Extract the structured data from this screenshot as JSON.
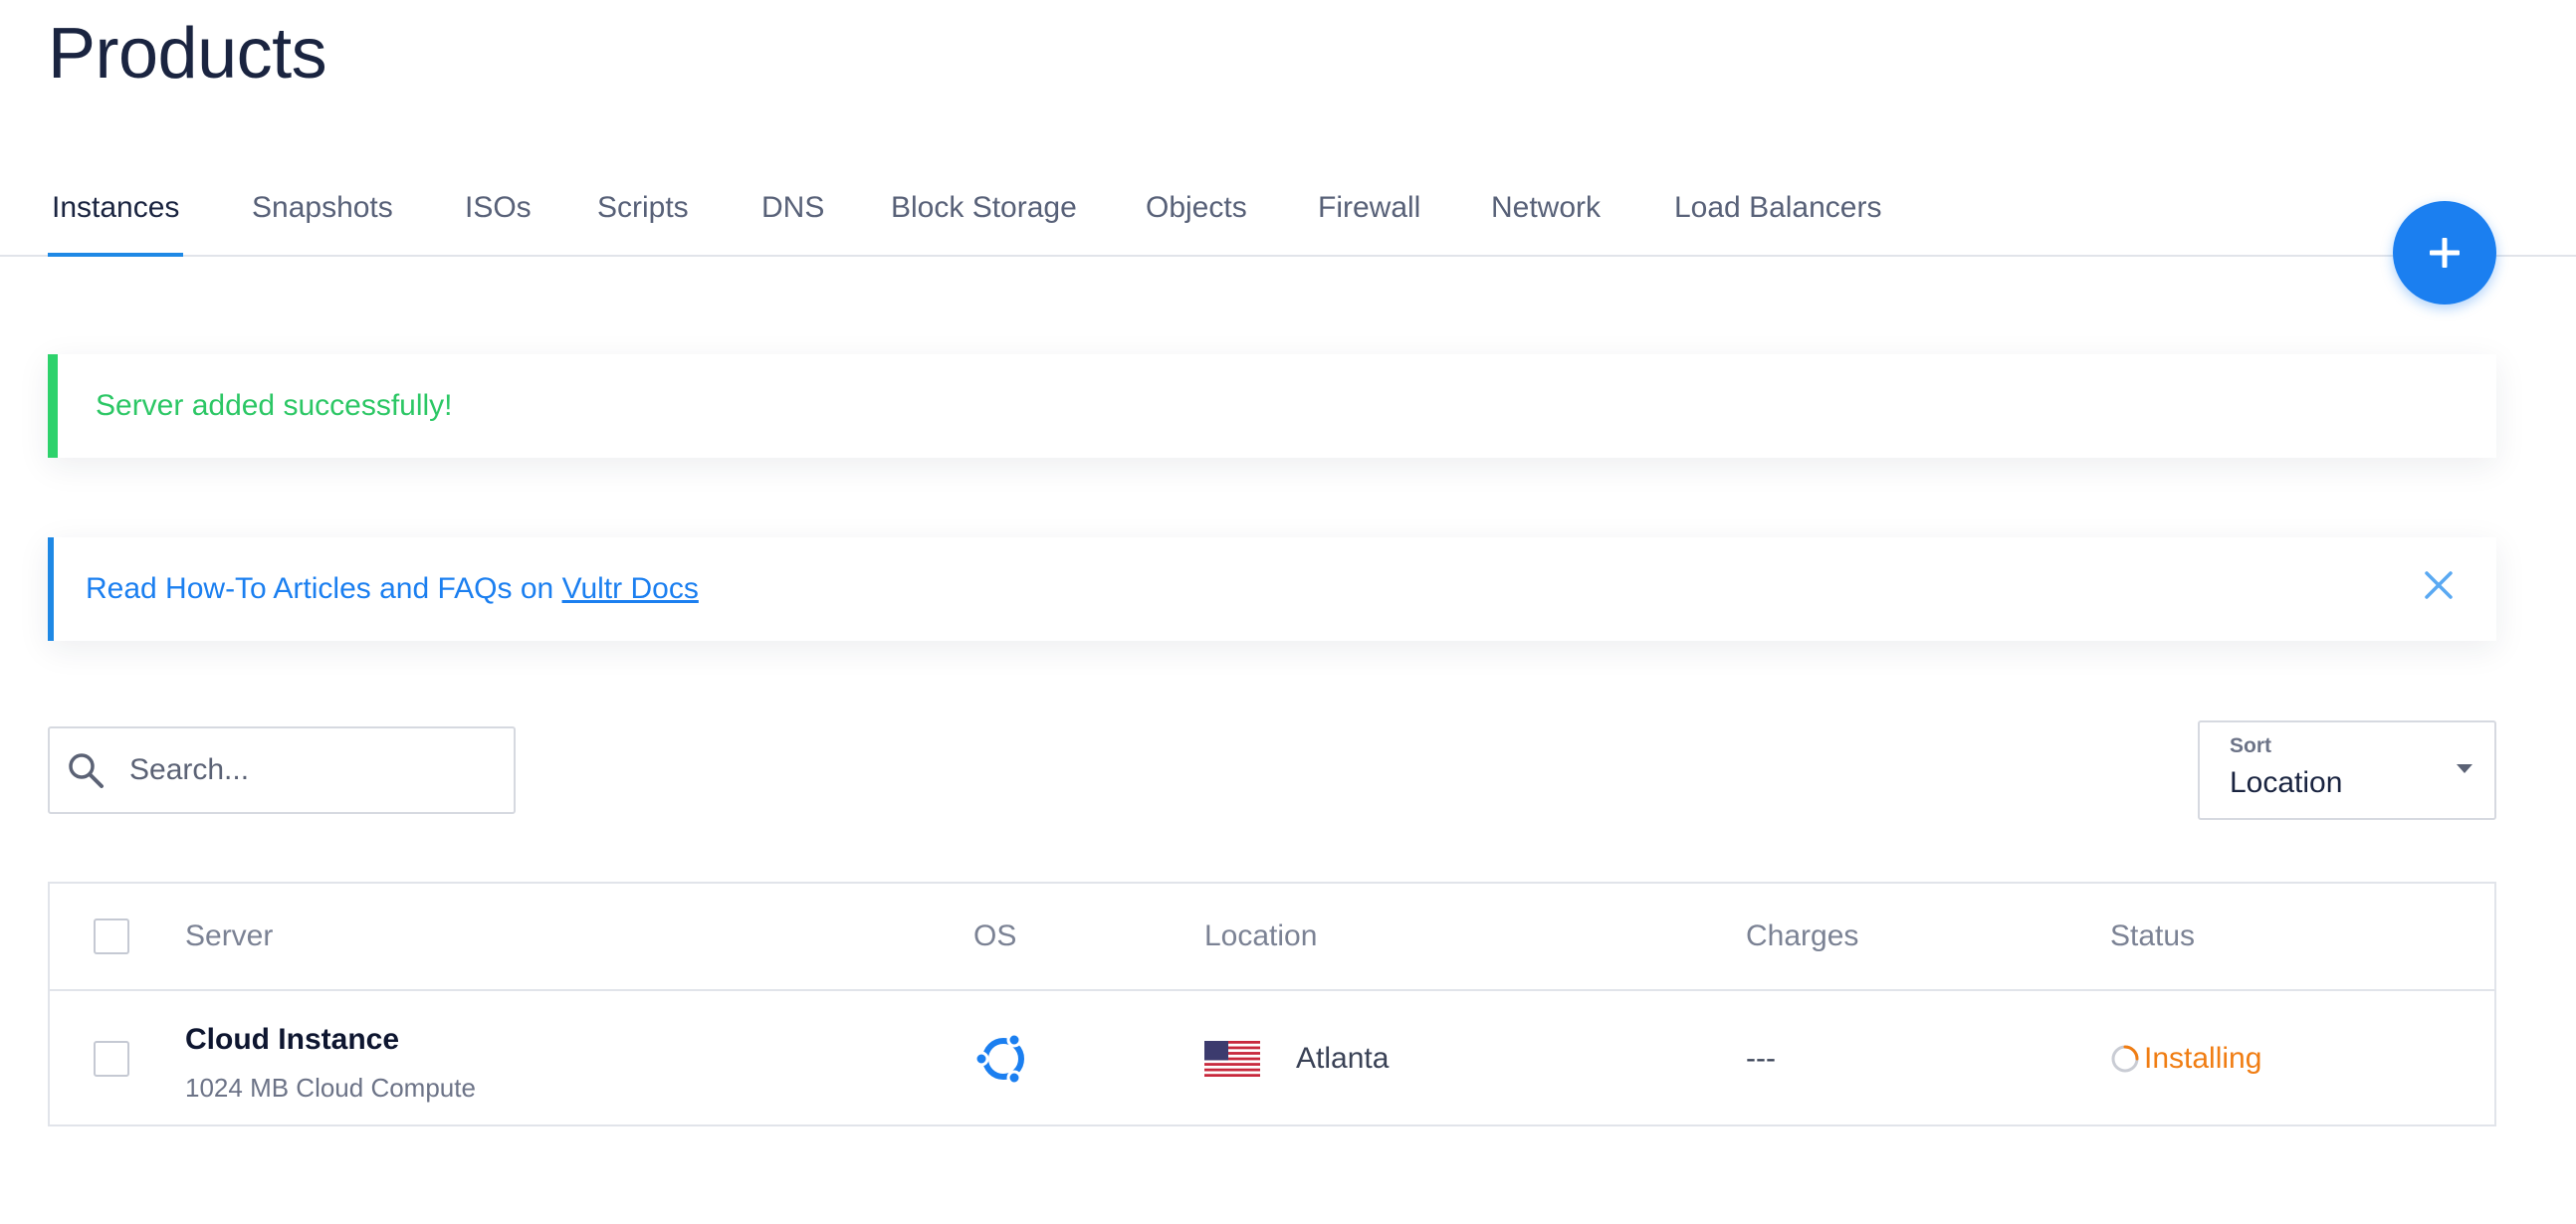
{
  "page": {
    "title": "Products"
  },
  "tabs": [
    {
      "label": "Instances",
      "active": true
    },
    {
      "label": "Snapshots",
      "active": false
    },
    {
      "label": "ISOs",
      "active": false
    },
    {
      "label": "Scripts",
      "active": false
    },
    {
      "label": "DNS",
      "active": false
    },
    {
      "label": "Block Storage",
      "active": false
    },
    {
      "label": "Objects",
      "active": false
    },
    {
      "label": "Firewall",
      "active": false
    },
    {
      "label": "Network",
      "active": false
    },
    {
      "label": "Load Balancers",
      "active": false
    }
  ],
  "fab": {
    "icon": "plus-icon"
  },
  "alerts": {
    "success": {
      "text": "Server added successfully!",
      "color": "#2dd26b"
    },
    "info": {
      "text_prefix": "Read How-To Articles and FAQs on",
      "link_text": "Vultr Docs",
      "close_icon": "close-icon",
      "color": "#1e88e5"
    }
  },
  "search": {
    "placeholder": "Search...",
    "value": "",
    "icon": "search-icon"
  },
  "sort": {
    "label": "Sort",
    "value": "Location"
  },
  "table": {
    "columns": [
      "Server",
      "OS",
      "Location",
      "Charges",
      "Status"
    ],
    "rows": [
      {
        "name": "Cloud Instance",
        "plan": "1024 MB Cloud Compute",
        "os_icon": "ubuntu-icon",
        "location_flag": "us-flag-icon",
        "location": "Atlanta",
        "charges": "---",
        "status": "Installing",
        "status_color": "#f07d13"
      }
    ]
  },
  "colors": {
    "accent": "#1b7ff0",
    "title": "#1a2440",
    "success": "#2dd26b",
    "warning": "#f07d13"
  }
}
